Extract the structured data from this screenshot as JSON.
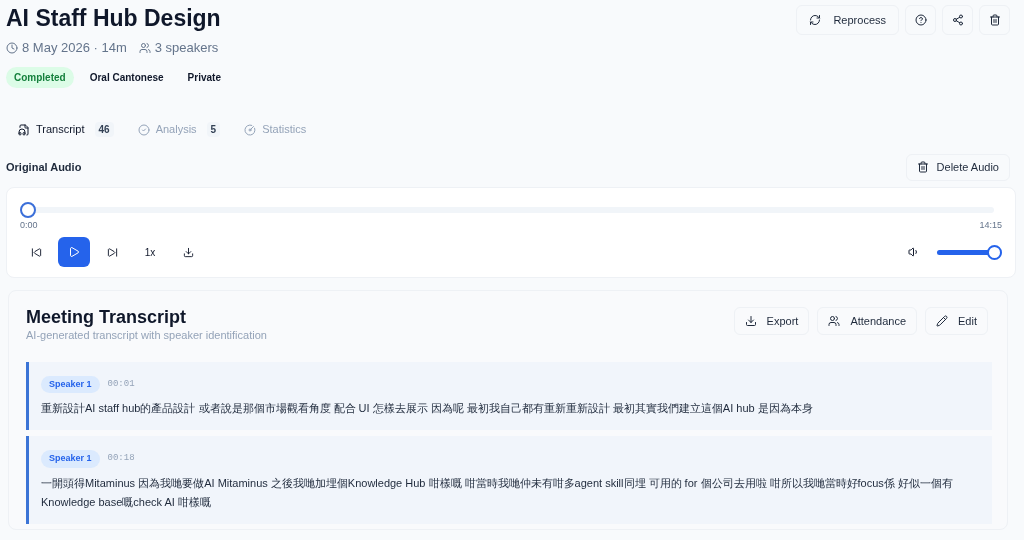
{
  "title": "AI Staff Hub Design",
  "meta": {
    "date": "8 May 2026 · 14m",
    "speakers": "3 speakers"
  },
  "badges": [
    {
      "label": "Completed",
      "kind": "status"
    },
    {
      "label": "Oral Cantonese",
      "kind": "plain"
    },
    {
      "label": "Private",
      "kind": "plain"
    }
  ],
  "header_actions": [
    {
      "kind": "reprocess",
      "label": "Reprocess"
    },
    {
      "kind": "help"
    },
    {
      "kind": "share"
    },
    {
      "kind": "delete"
    }
  ],
  "tabs": [
    {
      "kind": "transcript",
      "label": "Transcript",
      "count": "46",
      "selected": true
    },
    {
      "kind": "analysis",
      "label": "Analysis",
      "count": "5",
      "selected": false
    },
    {
      "kind": "statistics",
      "label": "Statistics",
      "selected": false
    }
  ],
  "audio": {
    "title": "Original Audio",
    "delete_label": "Delete Audio",
    "current": "0:00",
    "duration": "14:15",
    "level": 0,
    "speed": "1x",
    "volume": {
      "level": 1
    }
  },
  "transcript": {
    "title": "Meeting Transcript",
    "subtitle": "AI-generated transcript with speaker identification",
    "actions": [
      {
        "kind": "export",
        "label": "Export"
      },
      {
        "kind": "attendance",
        "label": "Attendance"
      },
      {
        "kind": "edit",
        "label": "Edit"
      }
    ],
    "segments": [
      {
        "speaker": "Speaker 1",
        "time": "00:01",
        "text": "重新設計AI staff hub的產品設計 或者說是那個市場觀看角度 配合 UI 怎樣去展示 因為呢 最初我自己都有重新重新設計 最初其實我們建立這個AI hub 是因為本身"
      },
      {
        "speaker": "Speaker 1",
        "time": "00:18",
        "text": "一開頭得Mitaminus 因為我哋要做AI Mitaminus 之後我哋加埋個Knowledge Hub 咁樣嘅 咁當時我哋仲未有咁多agent skill同埋 可用的 for 個公司去用啦 咁所以我哋當時好focus係 好似一個有 Knowledge base嘅check AI 咁樣嘅"
      }
    ]
  }
}
